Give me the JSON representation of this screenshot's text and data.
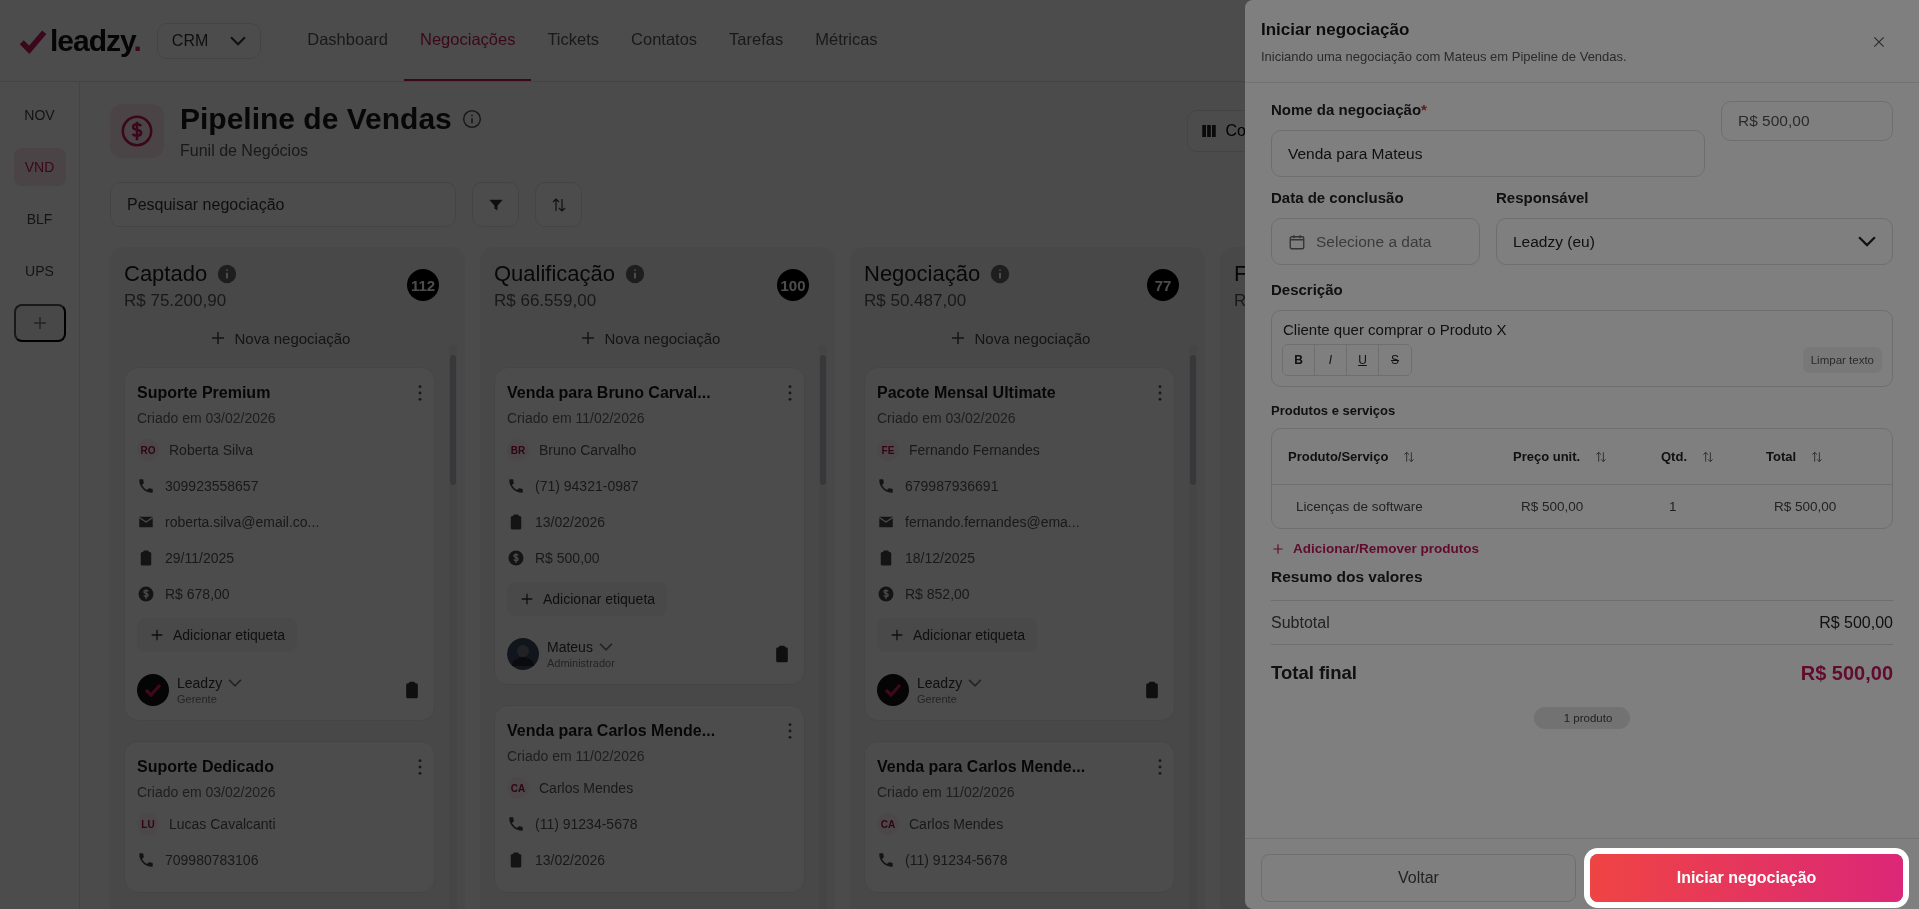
{
  "header": {
    "logo": {
      "text": "leadzy",
      "mark": "."
    },
    "workspace": "CRM",
    "nav": [
      {
        "label": "Dashboard",
        "selected": false
      },
      {
        "label": "Negociações",
        "selected": true
      },
      {
        "label": "Tickets",
        "selected": false
      },
      {
        "label": "Contatos",
        "selected": false
      },
      {
        "label": "Tarefas",
        "selected": false
      },
      {
        "label": "Métricas",
        "selected": false
      }
    ]
  },
  "sidebar": {
    "items": [
      {
        "label": "NOV",
        "selected": false
      },
      {
        "label": "VND",
        "selected": true
      },
      {
        "label": "BLF",
        "selected": false
      },
      {
        "label": "UPS",
        "selected": false
      }
    ]
  },
  "page": {
    "title": "Pipeline de Vendas",
    "subtitle": "Funil de Negócios",
    "view_button": "Co",
    "search": {
      "placeholder": "Pesquisar negociação"
    }
  },
  "columns": [
    {
      "title": "Captado",
      "total": "R$ 75.200,90",
      "count": "112",
      "new_label": "Nova negociação",
      "cards": [
        {
          "title": "Suporte Premium",
          "created": "Criado em 03/02/2026",
          "contact": {
            "initials": "RO",
            "name": "Roberta Silva"
          },
          "details": [
            {
              "kind": "phone",
              "text": "309923558657"
            },
            {
              "kind": "email",
              "text": "roberta.silva@email.co..."
            },
            {
              "kind": "date",
              "text": "29/11/2025"
            },
            {
              "kind": "value",
              "text": "R$ 678,00"
            }
          ],
          "tag_button": "Adicionar etiqueta",
          "owner": {
            "name": "Leadzy",
            "role": "Gerente",
            "kind": "logo"
          }
        },
        {
          "title": "Suporte Dedicado",
          "created": "Criado em 03/02/2026",
          "contact": {
            "initials": "LU",
            "name": "Lucas Cavalcanti"
          },
          "details": [
            {
              "kind": "phone",
              "text": "709980783106"
            }
          ]
        }
      ]
    },
    {
      "title": "Qualificação",
      "total": "R$ 66.559,00",
      "count": "100",
      "new_label": "Nova negociação",
      "cards": [
        {
          "title": "Venda para Bruno Carval...",
          "created": "Criado em 11/02/2026",
          "contact": {
            "initials": "BR",
            "name": "Bruno Carvalho"
          },
          "details": [
            {
              "kind": "phone",
              "text": "(71) 94321-0987"
            },
            {
              "kind": "date",
              "text": "13/02/2026"
            },
            {
              "kind": "value",
              "text": "R$ 500,00"
            }
          ],
          "tag_button": "Adicionar etiqueta",
          "owner": {
            "name": "Mateus",
            "role": "Administrador",
            "kind": "photo"
          }
        },
        {
          "title": "Venda para Carlos Mende...",
          "created": "Criado em 11/02/2026",
          "contact": {
            "initials": "CA",
            "name": "Carlos Mendes"
          },
          "details": [
            {
              "kind": "phone",
              "text": "(11) 91234-5678"
            },
            {
              "kind": "date",
              "text": "13/02/2026"
            }
          ]
        }
      ]
    },
    {
      "title": "Negociação",
      "total": "R$ 50.487,00",
      "count": "77",
      "new_label": "Nova negociação",
      "cards": [
        {
          "title": "Pacote Mensal Ultimate",
          "created": "Criado em 03/02/2026",
          "contact": {
            "initials": "FE",
            "name": "Fernando Fernandes"
          },
          "details": [
            {
              "kind": "phone",
              "text": "679987936691"
            },
            {
              "kind": "email",
              "text": "fernando.fernandes@ema..."
            },
            {
              "kind": "date",
              "text": "18/12/2025"
            },
            {
              "kind": "value",
              "text": "R$ 852,00"
            }
          ],
          "tag_button": "Adicionar etiqueta",
          "owner": {
            "name": "Leadzy",
            "role": "Gerente",
            "kind": "logo"
          }
        },
        {
          "title": "Venda para Carlos Mende...",
          "created": "Criado em 11/02/2026",
          "contact": {
            "initials": "CA",
            "name": "Carlos Mendes"
          },
          "details": [
            {
              "kind": "phone",
              "text": "(11) 91234-5678"
            }
          ]
        }
      ]
    },
    {
      "title": "F",
      "total": "R"
    }
  ],
  "drawer": {
    "title": "Iniciar negociação",
    "subtitle": "Iniciando uma negociação com Mateus em Pipeline de Vendas.",
    "name_label": "Nome da negociação",
    "required_mark": "*",
    "name_value": "Venda para Mateus",
    "amount_value": "R$ 500,00",
    "date_label": "Data de conclusão",
    "date_placeholder": "Selecione a data",
    "owner_label": "Responsável",
    "owner_value": "Leadzy (eu)",
    "description_label": "Descrição",
    "description_value": "Cliente quer comprar o Produto X",
    "format_buttons": [
      {
        "label": "B",
        "kind": "bold"
      },
      {
        "label": "I",
        "kind": "italic"
      },
      {
        "label": "U",
        "kind": "underline"
      },
      {
        "label": "S",
        "kind": "strike"
      }
    ],
    "clear_button": "Limpar texto",
    "products_label": "Produtos e serviços",
    "table": {
      "columns": [
        "Produto/Serviço",
        "Preço unit.",
        "Qtd.",
        "Total"
      ],
      "rows": [
        [
          "Licenças de software",
          "R$ 500,00",
          "1",
          "R$ 500,00"
        ]
      ]
    },
    "add_products": "Adicionar/Remover produtos",
    "summary_title": "Resumo dos valores",
    "subtotal_label": "Subtotal",
    "subtotal_value": "R$ 500,00",
    "total_label": "Total final",
    "total_value": "R$ 500,00",
    "count_pill": "1 produto",
    "back_button": "Voltar",
    "submit_button": "Iniciar negociação"
  }
}
